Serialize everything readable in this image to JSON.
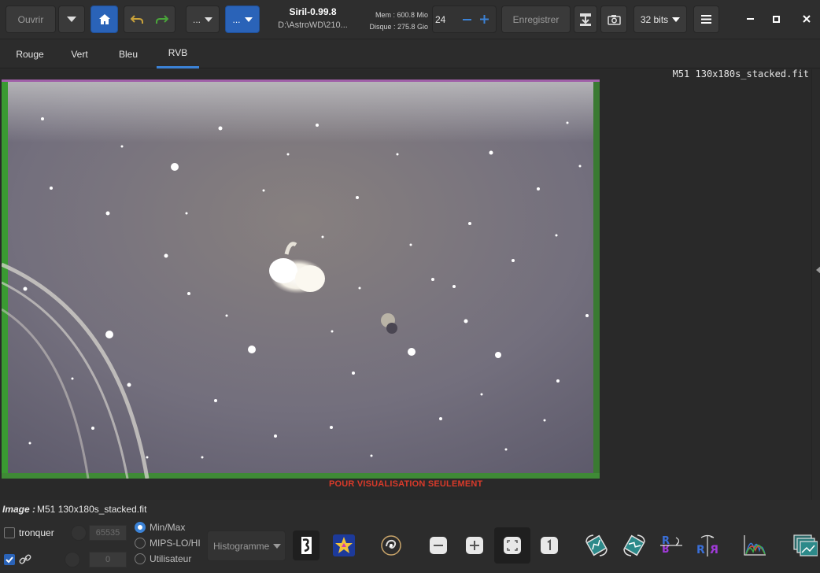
{
  "header": {
    "open_label": "Ouvrir",
    "app_title": "Siril-0.99.8",
    "path": "D:\\AstroWD\\210...",
    "mem": "Mem : 600.8 Mio",
    "disk": "Disque : 275.8 Gio",
    "zoom_value": "24",
    "save_label": "Enregistrer",
    "bit_depth": "32 bits",
    "scripts_label": "...",
    "processing_label": "..."
  },
  "tabs": [
    "Rouge",
    "Vert",
    "Bleu",
    "RVB"
  ],
  "active_tab": "RVB",
  "viewer": {
    "filename": "M51 130x180s_stacked.fit",
    "watermark": "POUR VISUALISATION SEULEMENT"
  },
  "status": {
    "image_label": "Image :",
    "image_name": "M51 130x180s_stacked.fit"
  },
  "bottom": {
    "crop_label": "tronquer",
    "crop_checked": false,
    "link_checked": true,
    "high_value": "65535",
    "low_value": "0",
    "modes": [
      {
        "label": "Min/Max",
        "selected": true
      },
      {
        "label": "MIPS-LO/HI",
        "selected": false
      },
      {
        "label": "Utilisateur",
        "selected": false
      }
    ],
    "histogram_label": "Histogramme"
  },
  "colors": {
    "accent": "#2a63b8",
    "watermark": "#d93a2a",
    "background": "#2c2c2c"
  }
}
